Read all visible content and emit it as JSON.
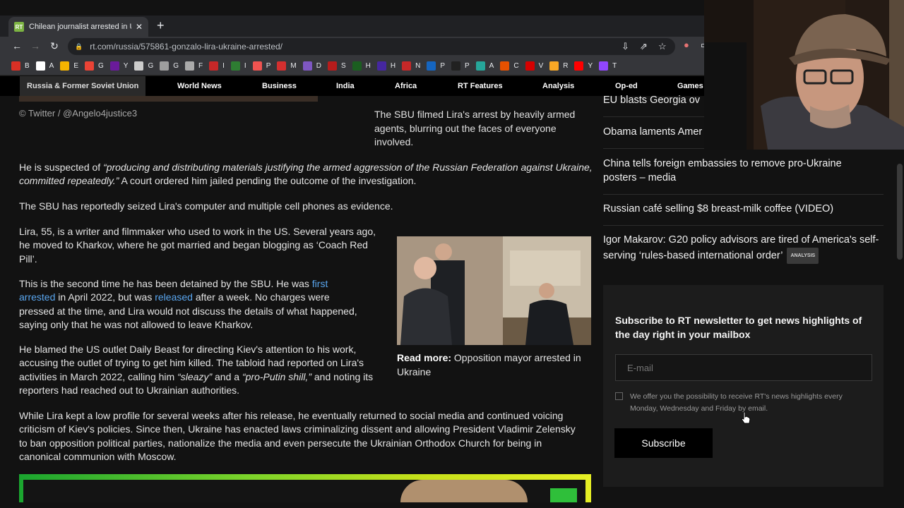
{
  "browser": {
    "tab_title": "Chilean journalist arrested in Ukr",
    "tab_favicon": "RT",
    "url": "rt.com/russia/575861-gonzalo-lira-ukraine-arrested/",
    "bookmarks": [
      {
        "letter": "B",
        "color": "#d93025"
      },
      {
        "letter": "A",
        "color": "#ffffff"
      },
      {
        "letter": "E",
        "color": "#f4b400"
      },
      {
        "letter": "G",
        "color": "#ea4335"
      },
      {
        "letter": "Y",
        "color": "#6a1b9a"
      },
      {
        "letter": "G",
        "color": "#cccccc"
      },
      {
        "letter": "G",
        "color": "#9e9e9e"
      },
      {
        "letter": "F",
        "color": "#aaaaaa"
      },
      {
        "letter": "I",
        "color": "#c62828"
      },
      {
        "letter": "I",
        "color": "#2e7d32"
      },
      {
        "letter": "P",
        "color": "#ef5350"
      },
      {
        "letter": "M",
        "color": "#d32f2f"
      },
      {
        "letter": "D",
        "color": "#7e57c2"
      },
      {
        "letter": "S",
        "color": "#b71c1c"
      },
      {
        "letter": "H",
        "color": "#1b5e20"
      },
      {
        "letter": "H",
        "color": "#4527a0"
      },
      {
        "letter": "N",
        "color": "#c62828"
      },
      {
        "letter": "P",
        "color": "#1565c0"
      },
      {
        "letter": "P",
        "color": "#212121"
      },
      {
        "letter": "A",
        "color": "#26a69a"
      },
      {
        "letter": "C",
        "color": "#e65100"
      },
      {
        "letter": "V",
        "color": "#d50000"
      },
      {
        "letter": "R",
        "color": "#f9a825"
      },
      {
        "letter": "Y",
        "color": "#ff0000"
      },
      {
        "letter": "T",
        "color": "#9146ff"
      }
    ]
  },
  "sitenav": {
    "items": [
      "Russia & Former Soviet Union",
      "World News",
      "Business",
      "India",
      "Africa",
      "RT Features",
      "Analysis",
      "Op-ed",
      "Games"
    ]
  },
  "article": {
    "photo_credit": "©  Twitter / @Angelo4justice3",
    "photo_caption": "The SBU filmed Lira's arrest by heavily armed agents, blurring out the faces of everyone involved.",
    "p1_pre": "He is suspected of ",
    "p1_quote": "“producing and distributing materials justifying the armed aggression of the Russian Federation against Ukraine, committed repeatedly.”",
    "p1_post": " A court ordered him jailed pending the outcome of the investigation.",
    "p2": "The SBU has reportedly seized Lira's computer and multiple cell phones as evidence.",
    "p3": "Lira, 55, is a writer and filmmaker who used to work in the US. Several years ago, he moved to Kharkov, where he got married and began blogging as ‘Coach Red Pill’.",
    "p4_pre": "This is the second time he has been detained by the SBU. He was ",
    "p4_link1": "first arrested",
    "p4_mid": " in April 2022, but was ",
    "p4_link2": "released",
    "p4_post": " after a week. No charges were pressed at the time, and Lira would not discuss the details of what happened, saying only that he was not allowed to leave Kharkov.",
    "p5_pre": "He blamed the US outlet Daily Beast for directing Kiev's attention to his work, accusing the outlet of trying to get him killed. The tabloid had reported on Lira's activities in March 2022, calling him ",
    "p5_q1": "“sleazy”",
    "p5_mid": " and a ",
    "p5_q2": "“pro-Putin shill,”",
    "p5_post": " and noting its reporters had reached out to Ukrainian authorities.",
    "p6": "While Lira kept a low profile for several weeks after his release, he eventually returned to social media and continued voicing criticism of Kiev's policies. Since then, Ukraine has enacted laws criminalizing dissent and allowing President Vladimir Zelensky to ban opposition political parties, nationalize the media and even persecute the Ukrainian Orthodox Church for being in canonical communion with Moscow.",
    "readmore_label": "Read more:",
    "readmore_text": " Opposition mayor arrested in Ukraine"
  },
  "sidebar": {
    "headlines": [
      "EU blasts Georgia ov",
      "Obama laments Amer",
      "China tells foreign embassies to remove pro-Ukraine posters – media",
      "Russian café selling $8 breast-milk coffee (VIDEO)",
      "Igor Makarov: G20 policy advisors are tired of America's self-serving ‘rules-based international order’"
    ],
    "analysis_badge": "ANALYSIS"
  },
  "newsletter": {
    "title": "Subscribe to RT newsletter to get news highlights of the day right in your mailbox",
    "email_placeholder": "E-mail",
    "note": "We offer you the possibility to receive RT's news highlights every Monday, Wednesday and Friday by email.",
    "button": "Subscribe"
  }
}
